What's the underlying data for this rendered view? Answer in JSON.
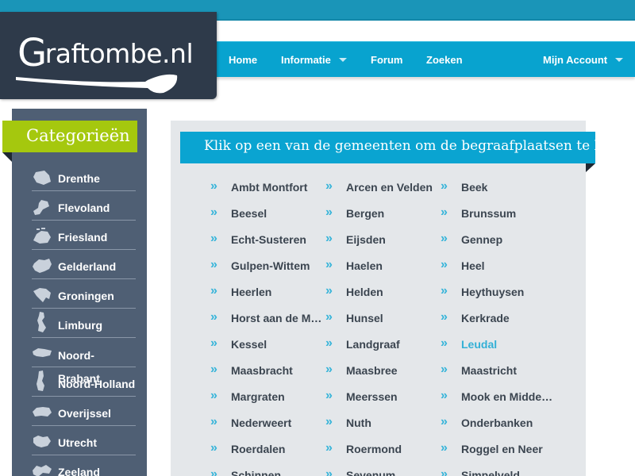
{
  "site": {
    "logo_initial": "G",
    "logo_rest": "raftombe.nl"
  },
  "nav": {
    "items": [
      {
        "label": "Home",
        "dropdown": false
      },
      {
        "label": "Informatie",
        "dropdown": true
      },
      {
        "label": "Forum",
        "dropdown": false
      },
      {
        "label": "Zoeken",
        "dropdown": false
      },
      {
        "label": "Mijn Account",
        "dropdown": true
      }
    ]
  },
  "sidebar": {
    "title": "Categorieën",
    "provinces": [
      {
        "label": "Drenthe",
        "icon": "drenthe-map-icon"
      },
      {
        "label": "Flevoland",
        "icon": "flevoland-map-icon"
      },
      {
        "label": "Friesland",
        "icon": "friesland-map-icon"
      },
      {
        "label": "Gelderland",
        "icon": "gelderland-map-icon"
      },
      {
        "label": "Groningen",
        "icon": "groningen-map-icon"
      },
      {
        "label": "Limburg",
        "icon": "limburg-map-icon"
      },
      {
        "label": "Noord-Brabant",
        "icon": "noord-brabant-map-icon"
      },
      {
        "label": "Noord-Holland",
        "icon": "noord-holland-map-icon"
      },
      {
        "label": "Overijssel",
        "icon": "overijssel-map-icon"
      },
      {
        "label": "Utrecht",
        "icon": "utrecht-map-icon"
      },
      {
        "label": "Zeeland",
        "icon": "zeeland-map-icon"
      }
    ]
  },
  "main": {
    "heading": "Klik op een van de gemeenten om de begraafplaatsen te bekijken",
    "arrow_glyph": "»",
    "municipalities": [
      {
        "label": "Ambt Montfort"
      },
      {
        "label": "Arcen en Velden"
      },
      {
        "label": "Beek"
      },
      {
        "label": "Beesel"
      },
      {
        "label": "Bergen"
      },
      {
        "label": "Brunssum"
      },
      {
        "label": "Echt-Susteren"
      },
      {
        "label": "Eijsden"
      },
      {
        "label": "Gennep"
      },
      {
        "label": "Gulpen-Wittem"
      },
      {
        "label": "Haelen"
      },
      {
        "label": "Heel"
      },
      {
        "label": "Heerlen"
      },
      {
        "label": "Helden"
      },
      {
        "label": "Heythuysen"
      },
      {
        "label": "Horst aan de Maas"
      },
      {
        "label": "Hunsel"
      },
      {
        "label": "Kerkrade"
      },
      {
        "label": "Kessel"
      },
      {
        "label": "Landgraaf"
      },
      {
        "label": "Leudal",
        "active": true
      },
      {
        "label": "Maasbracht"
      },
      {
        "label": "Maasbree"
      },
      {
        "label": "Maastricht"
      },
      {
        "label": "Margraten"
      },
      {
        "label": "Meerssen"
      },
      {
        "label": "Mook en Middelaar"
      },
      {
        "label": "Nederweert"
      },
      {
        "label": "Nuth"
      },
      {
        "label": "Onderbanken"
      },
      {
        "label": "Roerdalen"
      },
      {
        "label": "Roermond"
      },
      {
        "label": "Roggel en Neer"
      },
      {
        "label": "Schinnen"
      },
      {
        "label": "Sevenum"
      },
      {
        "label": "Simpelveld"
      }
    ]
  },
  "colors": {
    "nav_bg": "#08a3cf",
    "category_accent": "#a5c80e",
    "sidebar_bg": "#4f5f74",
    "active_link": "#33b0d6"
  }
}
